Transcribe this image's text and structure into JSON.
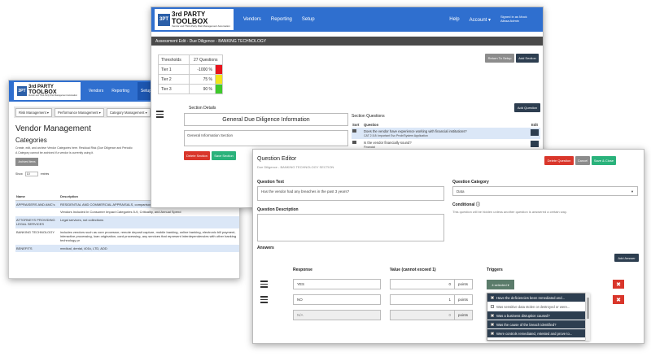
{
  "brand": {
    "mark": "3PT",
    "line1": "3rd PARTY",
    "line2": "TOOLBOX",
    "tag": "Vendor and Third-Party Risk Management Automation"
  },
  "vendor_window": {
    "nav": [
      "Vendors",
      "Reporting",
      "Setup"
    ],
    "menus": [
      "Risk Management ▾",
      "Performance Management ▾",
      "Category Management ▾"
    ],
    "title": "Vendor Management",
    "subtitle": "Categories",
    "description1": "Create, edit, and archive Vendor Categories here. Residual Risk (Due Diligence and Periodic",
    "description2": "A Category cannot be archived if a vendor is currently using it.",
    "archived_btn": "Archived Items",
    "show_label": "Show",
    "show_value": "10",
    "entries_label": "entries",
    "columns": [
      "Name",
      "Description"
    ],
    "rows": [
      {
        "name": "APPRAISERS AND AMC's",
        "desc": "RESIDENTIAL AND COMMERCIAL APPRAISALS, comparison"
      },
      {
        "name": "",
        "desc": "Vendors Included In Consumer Impact Categories 5-9, Criticality, and Annual Spend"
      },
      {
        "name": "ATTORNEYS PROVIDING LEGAL SERVICES",
        "desc": "Legal services, not collections"
      },
      {
        "name": "BANKING TECHNOLOGY",
        "desc": "includes vendors such as core processor, remote deposit capture, mobile banking, online banking, electronic bill payment, interactive processing, loan origination, card processing, any services that represent interdependencies with other banking technology pr"
      },
      {
        "name": "BENEFITS",
        "desc": "medical, dental, 401k, LTD, ADD"
      }
    ]
  },
  "assessment_window": {
    "nav_left": [
      "Vendors",
      "Reporting",
      "Setup"
    ],
    "nav_right": [
      "Help",
      "Account ▾"
    ],
    "signed_in": "Signed in as Mock Alissa Admin",
    "header": "Assessment Edit - Due Diligence - BANKING TECHNOLOGY",
    "thresholds": {
      "label": "Thresholds",
      "count": "27 Questions",
      "rows": [
        {
          "tier": "Tier 1",
          "value": "-1000 %",
          "color": "#e8141d"
        },
        {
          "tier": "Tier 2",
          "value": "75 %",
          "color": "#f2e41c"
        },
        {
          "tier": "Tier 3",
          "value": "90 %",
          "color": "#3fc92b"
        }
      ]
    },
    "return_btn": "Return To Setup",
    "add_section_btn": "Add Section",
    "section_details_label": "Section Details",
    "section_title": "General Due Diligence Information",
    "section_desc": "General Information Section",
    "delete_section_btn": "Delete Section",
    "save_section_btn": "Save Section",
    "add_question_btn": "Add Question",
    "section_questions_label": "Section Questions",
    "sq_cols": [
      "Sort",
      "Question",
      "Edit"
    ],
    "sq_rows": [
      {
        "q": "Does the vendor have experience working with financial institutions?",
        "sub": "CAT 2.5.8: Important Svc Prvdr/System Application"
      },
      {
        "q": "Is the vendor financially sound?",
        "sub": "Financial"
      }
    ]
  },
  "question_editor": {
    "title": "Question Editor",
    "subtitle": "Due Diligence - BANKING TECHNOLOGY SECTION",
    "delete_btn": "Delete Question",
    "cancel_btn": "Cancel",
    "save_btn": "Save & Close",
    "question_text_label": "Question Text",
    "question_text": "Has the vendor had any breaches in the past 3 years?",
    "question_desc_label": "Question Description",
    "question_category_label": "Question Category",
    "question_category": "Data",
    "conditional_label": "Conditional ⓘ",
    "conditional_note": "This question will be hidden unless another question is answered a certain way.",
    "answers_label": "Answers",
    "add_answer_btn": "Add Answer",
    "col_response": "Response",
    "col_value": "Value (cannot exceed 1)",
    "col_triggers": "Triggers",
    "answers": [
      {
        "response": "YES",
        "value": "0",
        "unit": "points"
      },
      {
        "response": "NO",
        "value": "1",
        "unit": "points"
      },
      {
        "response": "N/A",
        "value": "0",
        "unit": "points"
      }
    ],
    "triggers_btn": "4 selected ▾",
    "trigger_options": [
      {
        "label": "Have the deficiencies been remediated and...",
        "checked": true
      },
      {
        "label": "Was sensitive data stolen or destroyed or were...",
        "checked": false
      },
      {
        "label": "Was a business disruption caused?",
        "checked": true
      },
      {
        "label": "Was the cause of the breach identified?",
        "checked": true
      },
      {
        "label": "Were controls remediated, retested and prove to...",
        "checked": true
      }
    ]
  },
  "colors": {
    "nav_blue": "#2f6fcf",
    "dark": "#2d3e50",
    "danger": "#d9362b",
    "success": "#2ab27b"
  }
}
